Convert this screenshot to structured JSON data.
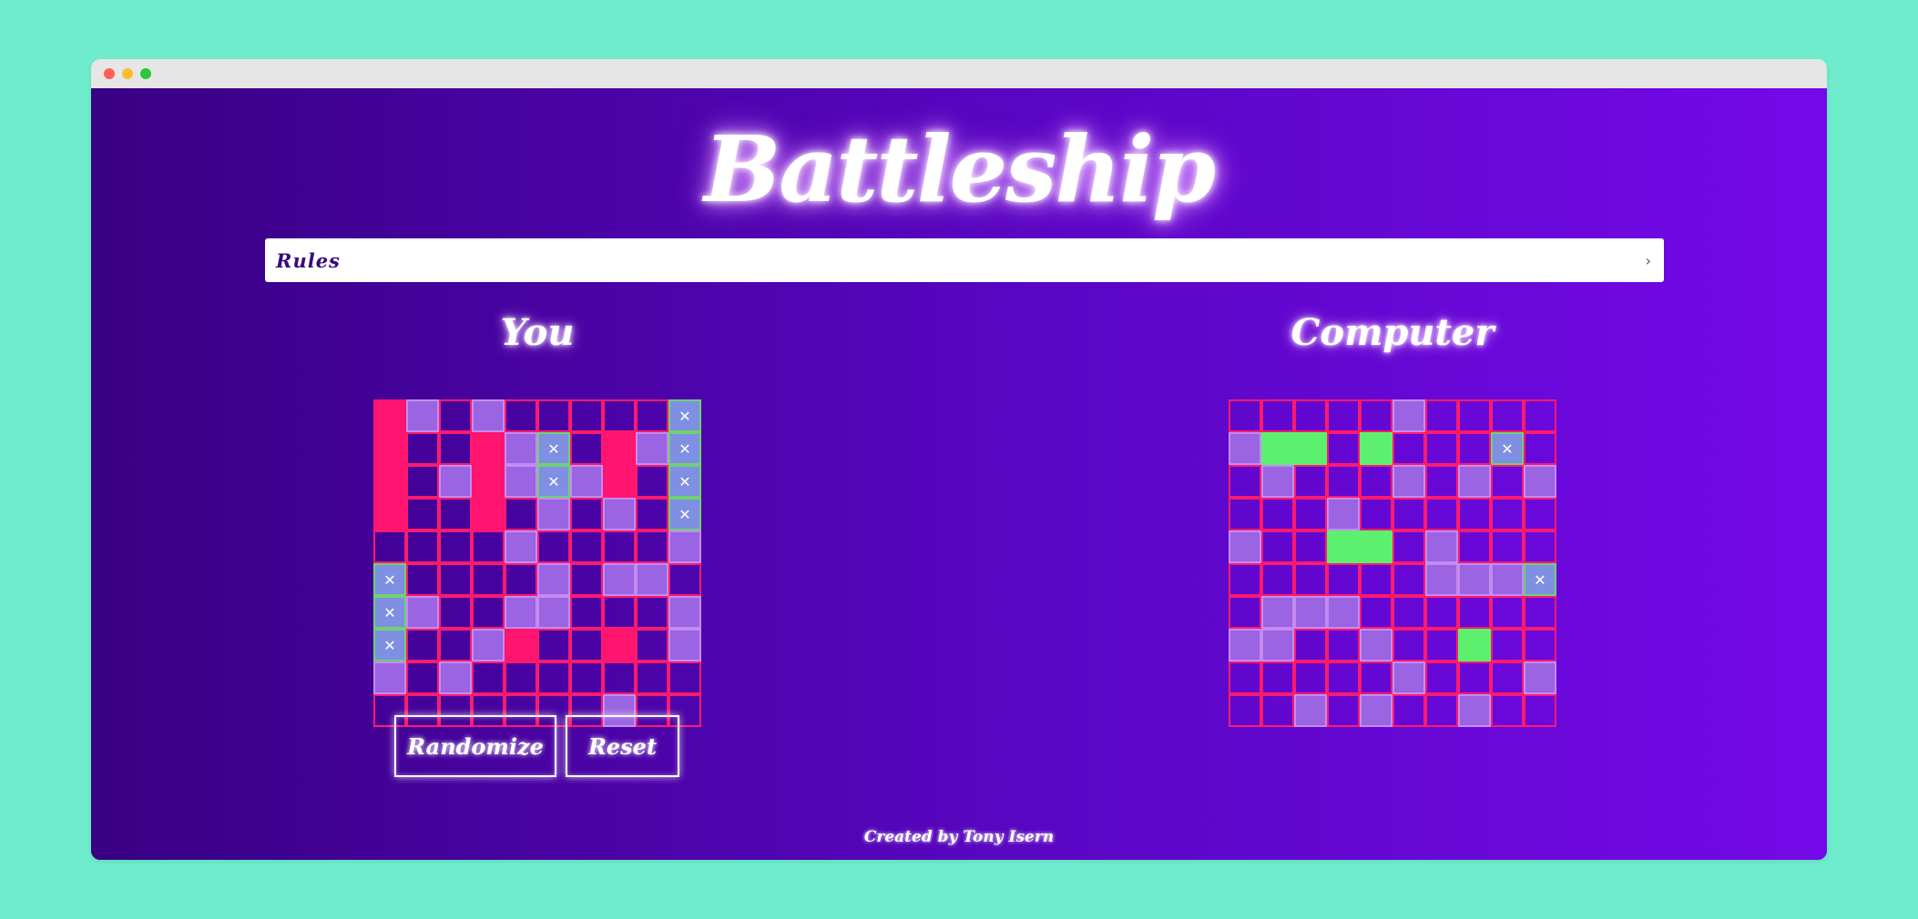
{
  "app": {
    "title": "Battleship",
    "footer": "Created by Tony Isern"
  },
  "rules": {
    "label": "Rules",
    "chevron": "›"
  },
  "player": {
    "title": "You",
    "grid": [
      "SM.M.....X",
      "S..SMX.SMX",
      "S.MSMXMS.X",
      "S..S.M.M.X",
      "....M....M",
      "X....M.MM.",
      "XM..MM...M",
      "X..MS..S.M",
      "M.M.......",
      ".......M.."
    ]
  },
  "computer": {
    "title": "Computer",
    "grid": [
      ".....M....",
      "MGG.G...X.",
      ".M...M.M.M",
      "...M......",
      "M..GG.M...",
      "......MMMX",
      ".MMM......",
      "MM..M..G..",
      ".....M...M",
      "..M.M..M.."
    ]
  },
  "legend": {
    ".": "empty",
    "M": "miss",
    "S": "ship",
    "X": "hit",
    "G": "sunk"
  },
  "buttons": {
    "randomize": "Randomize",
    "reset": "Reset"
  },
  "colors": {
    "background": "#6eeccc",
    "grid_line": "#ff1a6d",
    "ship": "#ff1470",
    "miss": "#9a64e2",
    "hit": "#7f90e3",
    "sunk": "#5cf06e"
  }
}
